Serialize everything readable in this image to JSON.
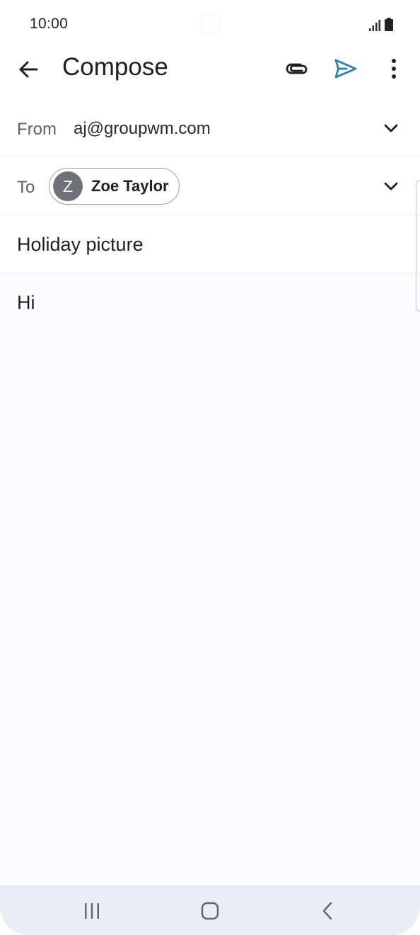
{
  "status_bar": {
    "time": "10:00",
    "icons": [
      "signal-icon",
      "battery-icon"
    ]
  },
  "app_bar": {
    "title": "Compose",
    "icons": [
      "back-arrow-icon",
      "paperclip-icon",
      "send-icon",
      "more-vert-icon"
    ]
  },
  "from": {
    "label": "From",
    "value": "aj@groupwm.com"
  },
  "to": {
    "label": "To",
    "recipients": [
      {
        "initial": "Z",
        "name": "Zoe Taylor"
      }
    ]
  },
  "subject": {
    "value": "Holiday picture"
  },
  "body": {
    "value": "Hi"
  },
  "colors": {
    "accent": "#2a7fa6",
    "avatar": "#6f7377",
    "nav_bar": "#e8eef5"
  },
  "nav_bar": {
    "icons": [
      "recents-icon",
      "home-icon",
      "nav-back-icon"
    ]
  }
}
